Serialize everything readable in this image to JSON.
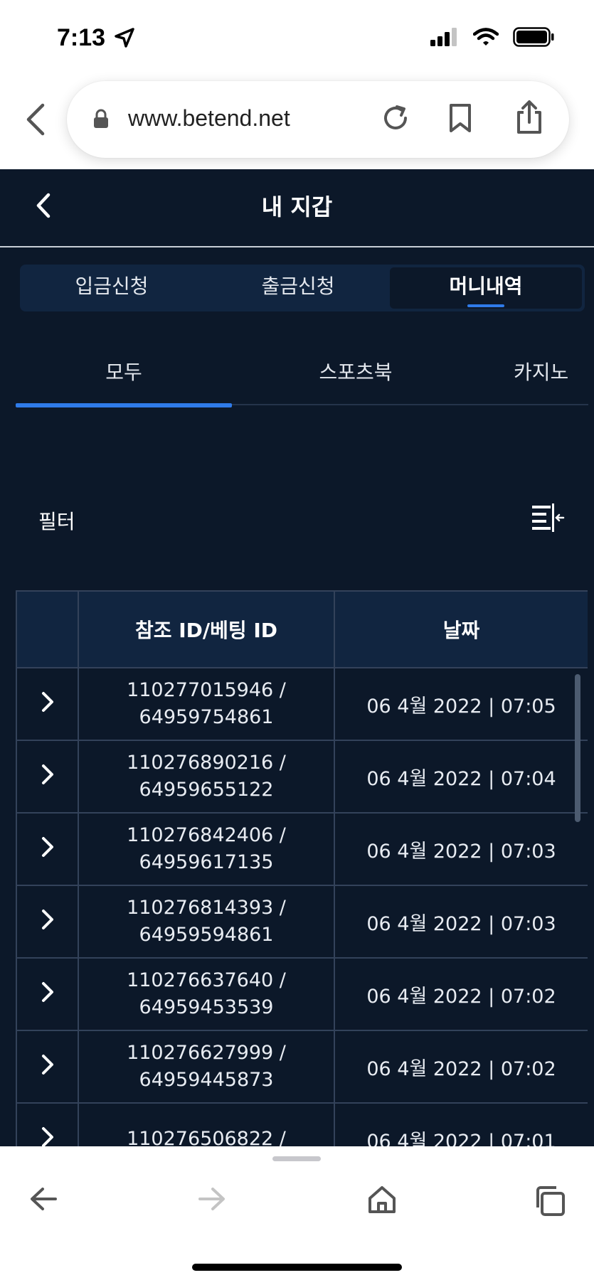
{
  "status_bar": {
    "time": "7:13"
  },
  "browser": {
    "url": "www.betend.net"
  },
  "app": {
    "title": "내 지갑",
    "segments": [
      {
        "label": "입금신청",
        "active": false
      },
      {
        "label": "출금신청",
        "active": false
      },
      {
        "label": "머니내역",
        "active": true
      }
    ],
    "subtabs": [
      {
        "label": "모두",
        "active": true
      },
      {
        "label": "스포츠북",
        "active": false
      },
      {
        "label": "카지노",
        "active": false
      }
    ],
    "filter_label": "필터",
    "table": {
      "headers": [
        "",
        "참조 ID/베팅 ID",
        "날짜"
      ],
      "rows": [
        {
          "ref_id": "110277015946 /",
          "bet_id": "64959754861",
          "date": "06 4월 2022 | 07:05"
        },
        {
          "ref_id": "110276890216 /",
          "bet_id": "64959655122",
          "date": "06 4월 2022 | 07:04"
        },
        {
          "ref_id": "110276842406 /",
          "bet_id": "64959617135",
          "date": "06 4월 2022 | 07:03"
        },
        {
          "ref_id": "110276814393 /",
          "bet_id": "64959594861",
          "date": "06 4월 2022 | 07:03"
        },
        {
          "ref_id": "110276637640 /",
          "bet_id": "64959453539",
          "date": "06 4월 2022 | 07:02"
        },
        {
          "ref_id": "110276627999 /",
          "bet_id": "64959445873",
          "date": "06 4월 2022 | 07:02"
        },
        {
          "ref_id": "110276506822 /",
          "bet_id": "",
          "date": "06 4월 2022 | 07:01"
        }
      ]
    }
  },
  "colors": {
    "app_bg": "#0c1829",
    "panel_bg": "#112540",
    "accent": "#2f7be9",
    "border": "#33425a"
  },
  "icons": {
    "status": [
      "location-arrow-icon",
      "signal-icon",
      "wifi-icon",
      "battery-icon"
    ],
    "browser": [
      "back-icon",
      "lock-icon",
      "reload-icon",
      "bookmark-icon",
      "share-icon"
    ],
    "toolbar": [
      "back-arrow-icon",
      "forward-arrow-icon",
      "home-icon",
      "tabs-icon"
    ]
  }
}
